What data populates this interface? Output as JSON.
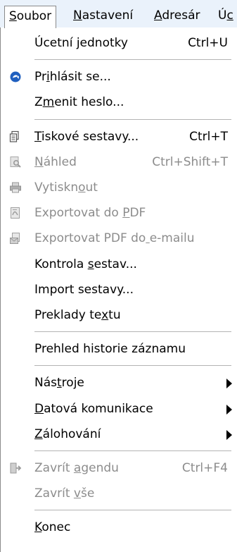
{
  "menubar": {
    "items": [
      {
        "label": "Soubor",
        "mnemonic_index": 0,
        "active": true
      },
      {
        "label": "Nastavení",
        "mnemonic_index": 0
      },
      {
        "label": "Adresár",
        "mnemonic_index": 0
      },
      {
        "label": "Úc",
        "mnemonic_index": 1
      }
    ]
  },
  "dropdown": {
    "items": [
      {
        "type": "item",
        "label": "Úcetní jednotky",
        "shortcut": "Ctrl+U",
        "enabled": true,
        "icon": null,
        "mnemonic_index": -1
      },
      {
        "type": "separator"
      },
      {
        "type": "item",
        "label": "Prihlásit se...",
        "shortcut": "",
        "enabled": true,
        "icon": "login-icon",
        "mnemonic_index": 2
      },
      {
        "type": "item",
        "label": "Zmenit heslo...",
        "shortcut": "",
        "enabled": true,
        "icon": null,
        "mnemonic_index": 1
      },
      {
        "type": "separator"
      },
      {
        "type": "item",
        "label": "Tiskové sestavy...",
        "shortcut": "Ctrl+T",
        "enabled": true,
        "icon": "print-reports-icon",
        "mnemonic_index": 0
      },
      {
        "type": "item",
        "label": "Náhled",
        "shortcut": "Ctrl+Shift+T",
        "enabled": false,
        "icon": "preview-icon",
        "mnemonic_index": 0
      },
      {
        "type": "item",
        "label": "Vytisknout",
        "shortcut": "",
        "enabled": false,
        "icon": "printer-icon",
        "mnemonic_index": 7
      },
      {
        "type": "item",
        "label": "Exportovat do PDF",
        "shortcut": "",
        "enabled": false,
        "icon": "pdf-export-icon",
        "mnemonic_index": 14
      },
      {
        "type": "item",
        "label": "Exportovat PDF do e-mailu",
        "shortcut": "",
        "enabled": false,
        "icon": "pdf-email-icon",
        "mnemonic_index": 17
      },
      {
        "type": "item",
        "label": "Kontrola sestav...",
        "shortcut": "",
        "enabled": true,
        "icon": null,
        "mnemonic_index": 9
      },
      {
        "type": "item",
        "label": "Import sestavy...",
        "shortcut": "",
        "enabled": true,
        "icon": null,
        "mnemonic_index": -1
      },
      {
        "type": "item",
        "label": "Preklady textu",
        "shortcut": "",
        "enabled": true,
        "icon": null,
        "mnemonic_index": 11
      },
      {
        "type": "separator"
      },
      {
        "type": "item",
        "label": "Prehled historie záznamu",
        "shortcut": "",
        "enabled": true,
        "icon": null,
        "mnemonic_index": -1
      },
      {
        "type": "separator"
      },
      {
        "type": "submenu",
        "label": "Nástroje",
        "shortcut": "",
        "enabled": true,
        "icon": null,
        "mnemonic_index": 3
      },
      {
        "type": "submenu",
        "label": "Datová komunikace",
        "shortcut": "",
        "enabled": true,
        "icon": null,
        "mnemonic_index": 0
      },
      {
        "type": "submenu",
        "label": "Zálohování",
        "shortcut": "",
        "enabled": true,
        "icon": null,
        "mnemonic_index": 0
      },
      {
        "type": "separator"
      },
      {
        "type": "item",
        "label": "Zavrít agendu",
        "shortcut": "Ctrl+F4",
        "enabled": false,
        "icon": "close-agenda-icon",
        "mnemonic_index": 7
      },
      {
        "type": "item",
        "label": "Zavrít vše",
        "shortcut": "",
        "enabled": false,
        "icon": null,
        "mnemonic_index": 7
      },
      {
        "type": "separator"
      },
      {
        "type": "item",
        "label": "Konec",
        "shortcut": "",
        "enabled": true,
        "icon": null,
        "mnemonic_index": 0
      }
    ]
  },
  "colors": {
    "menubar_bg": "#eaf2fb",
    "text": "#000000",
    "disabled_text": "#8c8c8c",
    "separator": "#b4b4b4",
    "login_icon": "#1f5fbf"
  }
}
